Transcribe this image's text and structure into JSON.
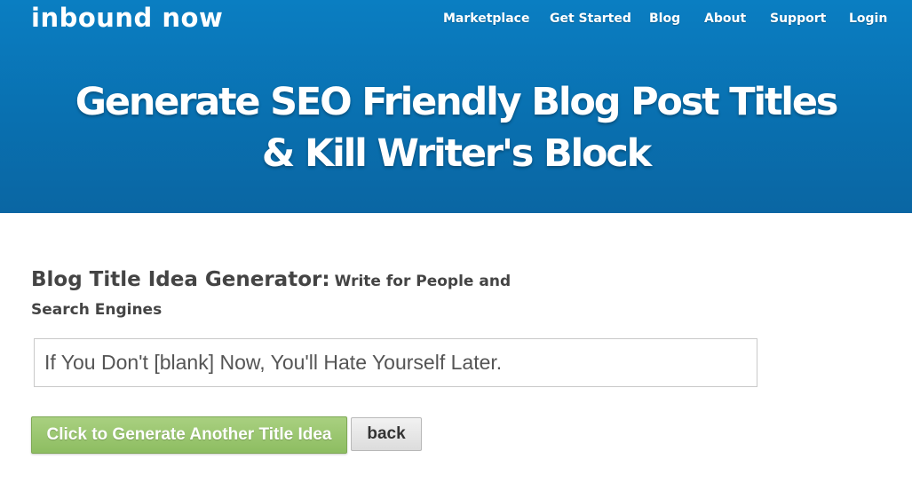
{
  "header": {
    "logo": "inbound now",
    "nav": [
      "Marketplace",
      "Get Started",
      "Blog",
      "About",
      "Support",
      "Login"
    ],
    "headline_line1": "Generate SEO Friendly Blog Post Titles",
    "headline_line2": "& Kill Writer's Block",
    "background_color": "#0a74b5"
  },
  "generator": {
    "heading": "Blog Title Idea Generator:",
    "subheading": "Write for People and Search Engines",
    "title_idea": "If You Don't [blank] Now, You'll Hate Yourself Later.",
    "generate_button": "Click to Generate Another Title Idea",
    "back_button": "back",
    "generate_button_color": "#8dbd61"
  }
}
